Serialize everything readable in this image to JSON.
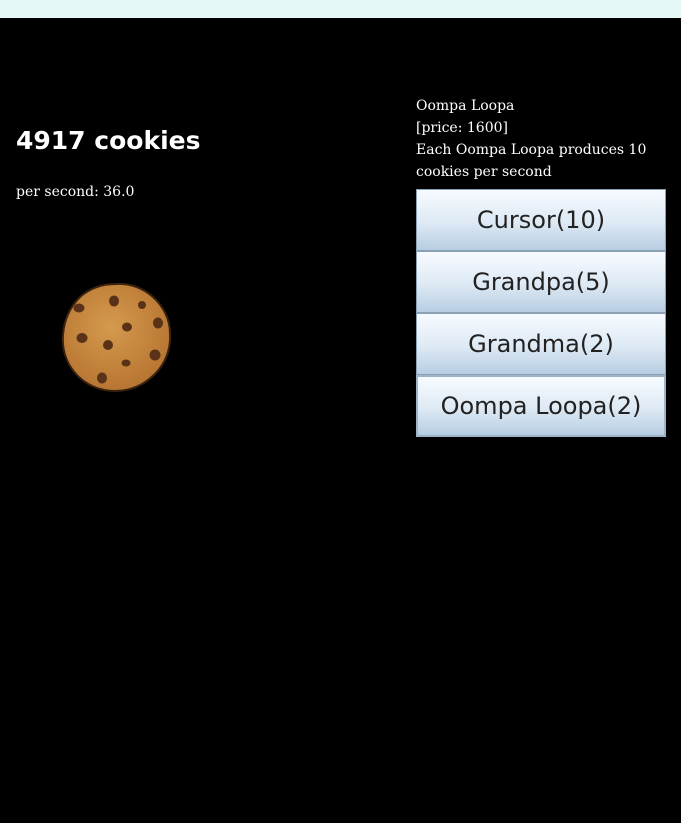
{
  "cookies": {
    "count_text": "4917 cookies",
    "per_second_text": "per second: 36.0"
  },
  "info": {
    "name": "Oompa Loopa",
    "price": "[price: 1600]",
    "description": "Each Oompa Loopa produces 10 cookies per second"
  },
  "shop": {
    "items": [
      {
        "label": "Cursor(10)"
      },
      {
        "label": "Grandpa(5)"
      },
      {
        "label": "Grandma(2)"
      },
      {
        "label": "Oompa Loopa(2)"
      }
    ]
  },
  "colors": {
    "background": "#000000",
    "topbar": "#e6f7f7",
    "cookie": "#c98a3e",
    "chip": "#5a3217"
  },
  "icons": {
    "cookie": "cookie-icon"
  }
}
